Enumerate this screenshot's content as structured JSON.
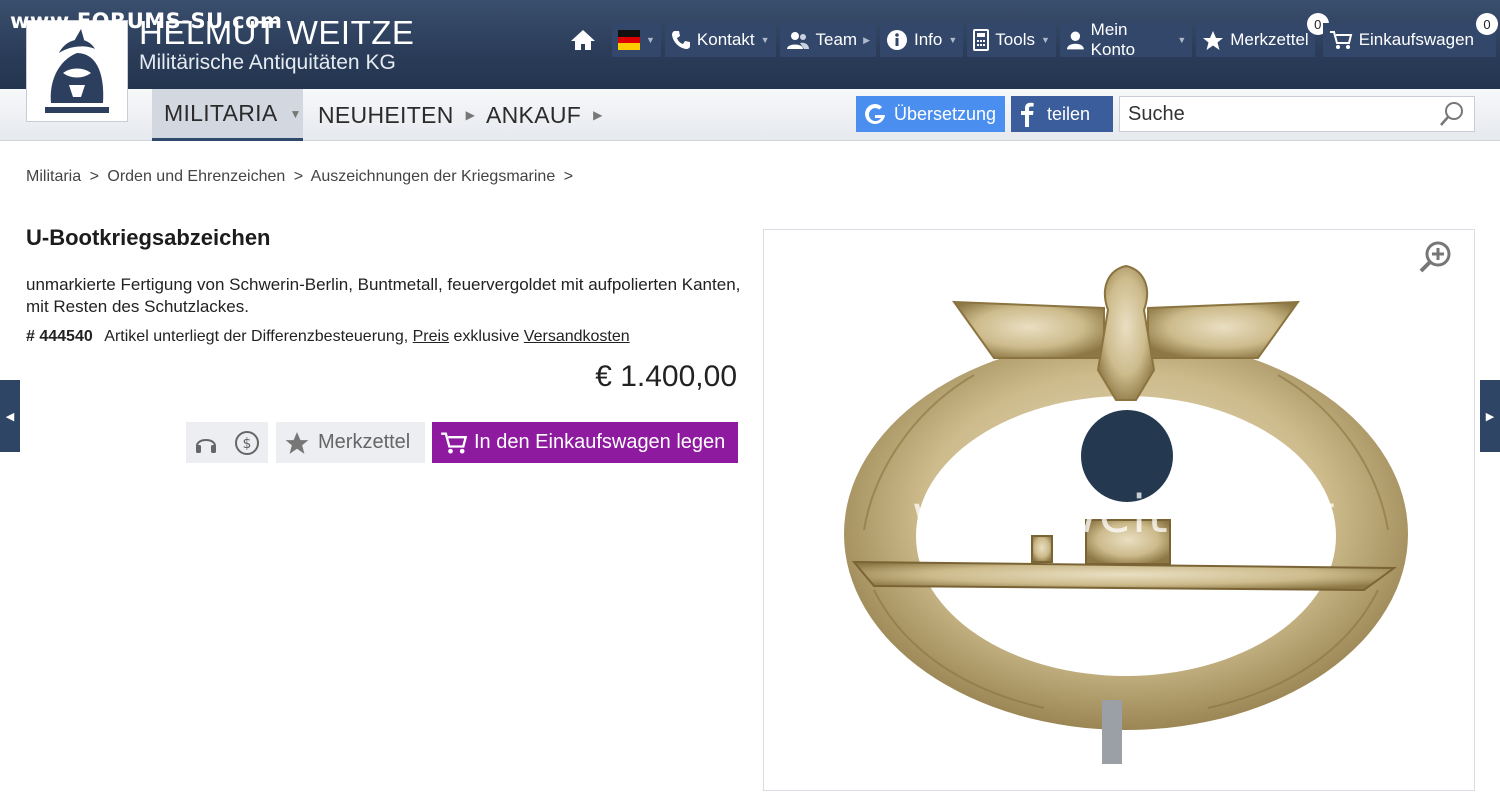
{
  "watermark": "www.FORUMS-SU.com",
  "brand": {
    "name": "HELMUT WEITZE",
    "subtitle": "Militärische Antiquitäten KG"
  },
  "top_nav": {
    "contact": "Kontakt",
    "team": "Team",
    "info": "Info",
    "tools": "Tools",
    "account": "Mein Konto",
    "wishlist": "Merkzettel",
    "wishlist_count": "0",
    "cart": "Einkaufswagen",
    "cart_count": "0"
  },
  "main_nav": {
    "militaria": "MILITARIA",
    "news": "NEUHEITEN",
    "purchase": "ANKAUF"
  },
  "translate_label": "Übersetzung",
  "share_label": "teilen",
  "search": {
    "placeholder": "Suche"
  },
  "breadcrumb": [
    "Militaria",
    ">",
    "Orden und Ehrenzeichen",
    ">",
    "Auszeichnungen der Kriegsmarine",
    ">"
  ],
  "product": {
    "title": "U-Bootkriegsabzeichen",
    "description": "unmarkierte Fertigung von Schwerin-Berlin, Buntmetall, feuervergoldet mit aufpolierten Kanten, mit Resten des Schutzlackes.",
    "number": "# 444540",
    "tax_note": "Artikel unterliegt der Differenzbesteuerung,",
    "price_link": "Preis",
    "exclusive": "exklusive",
    "shipping_link": "Versandkosten",
    "price": "€ 1.400,00",
    "wishlist_button": "Merkzettel",
    "cart_button": "In den Einkaufswagen legen",
    "image_watermark": "www.weitze.net"
  },
  "colors": {
    "header": "#2a3c58",
    "cart_button": "#8e1aa0",
    "translate": "#4a8ef0",
    "share": "#3b5d9b"
  }
}
